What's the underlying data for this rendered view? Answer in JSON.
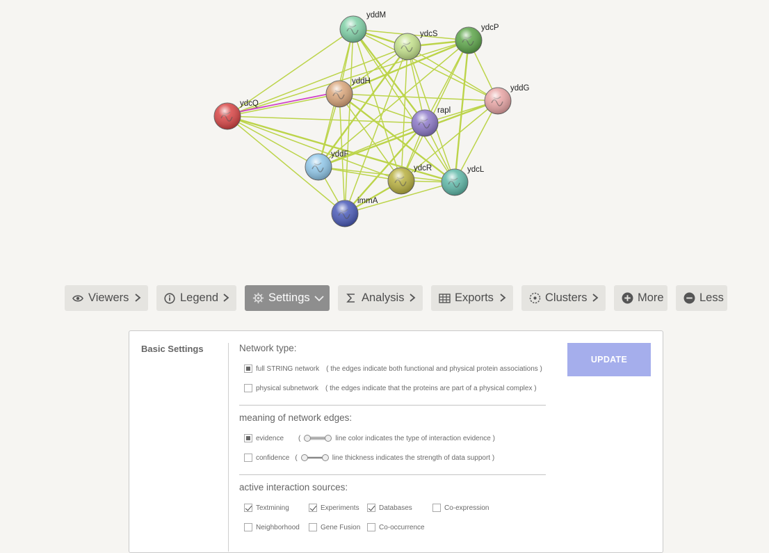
{
  "network": {
    "nodes": [
      {
        "id": "yddM",
        "label": "yddM",
        "color": "#7fd0a6"
      },
      {
        "id": "ydcS",
        "label": "ydcS",
        "color": "#c2e08a"
      },
      {
        "id": "ydcP",
        "label": "ydcP",
        "color": "#5da54a"
      },
      {
        "id": "yddG",
        "label": "yddG",
        "color": "#e8a5a5"
      },
      {
        "id": "yddH",
        "label": "yddH",
        "color": "#d9a57a"
      },
      {
        "id": "ydcQ",
        "label": "ydcQ",
        "color": "#d84545"
      },
      {
        "id": "rapl",
        "label": "rapl",
        "color": "#8c78c8"
      },
      {
        "id": "yddF",
        "label": "yddF",
        "color": "#8fc6e8"
      },
      {
        "id": "ydcR",
        "label": "ydcR",
        "color": "#b8b040"
      },
      {
        "id": "ydcL",
        "label": "ydcL",
        "color": "#5fb8a8"
      },
      {
        "id": "immA",
        "label": "immA",
        "color": "#4a5ab8"
      }
    ],
    "edge_color": "#bcd44a",
    "highlight_edge_color": "#d040c8",
    "highlight_edge": [
      "ydcQ",
      "yddH"
    ]
  },
  "toolbar": {
    "viewers": "Viewers",
    "legend": "Legend",
    "settings": "Settings",
    "analysis": "Analysis",
    "exports": "Exports",
    "clusters": "Clusters",
    "more": "More",
    "less": "Less"
  },
  "settings": {
    "title": "Basic Settings",
    "update": "UPDATE",
    "network_type": {
      "heading": "Network type:",
      "options": [
        {
          "label": "full STRING network",
          "desc": "( the edges indicate both functional and physical protein associations )",
          "selected": true
        },
        {
          "label": "physical subnetwork",
          "desc": "( the edges indicate that the proteins are part of a physical complex )",
          "selected": false
        }
      ]
    },
    "edges_meaning": {
      "heading": "meaning of network edges:",
      "options": [
        {
          "label": "evidence",
          "desc": "line color indicates the type of interaction evidence )",
          "open_paren": "(",
          "selected": true
        },
        {
          "label": "confidence",
          "desc": "line thickness indicates the strength of data support )",
          "open_paren": "(",
          "selected": false
        }
      ]
    },
    "sources": {
      "heading": "active interaction sources:",
      "items": [
        {
          "label": "Textmining",
          "checked": true
        },
        {
          "label": "Experiments",
          "checked": true
        },
        {
          "label": "Databases",
          "checked": true
        },
        {
          "label": "Co-expression",
          "checked": false
        },
        {
          "label": "Neighborhood",
          "checked": false
        },
        {
          "label": "Gene Fusion",
          "checked": false
        },
        {
          "label": "Co-occurrence",
          "checked": false
        }
      ]
    }
  }
}
